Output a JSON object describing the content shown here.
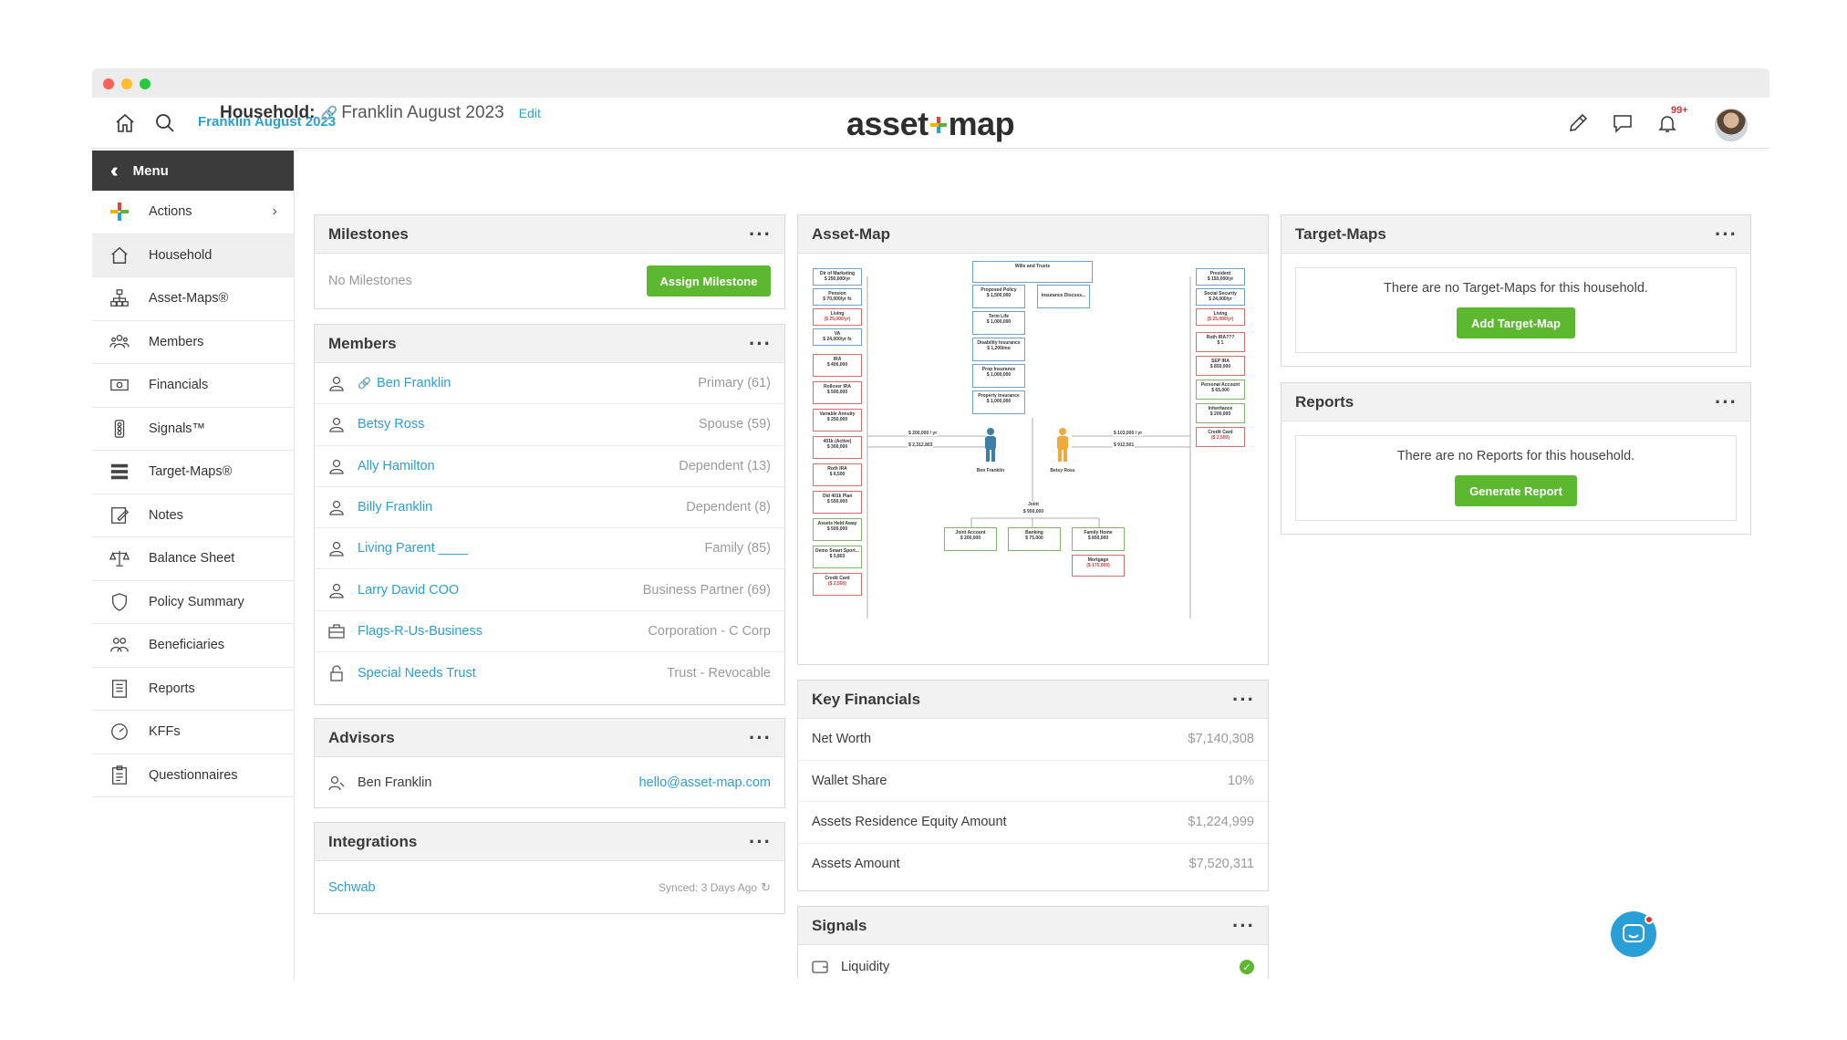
{
  "topnav": {
    "household": "Franklin August 2023",
    "logo_left": "asset",
    "logo_right": "map",
    "notification_count": "99+"
  },
  "sidebar": {
    "menu_label": "Menu",
    "items": [
      {
        "label": "Actions",
        "icon": "actions-plus-icon"
      },
      {
        "label": "Household",
        "icon": "house-icon"
      },
      {
        "label": "Asset-Maps®",
        "icon": "asset-map-icon"
      },
      {
        "label": "Members",
        "icon": "members-icon"
      },
      {
        "label": "Financials",
        "icon": "financials-icon"
      },
      {
        "label": "Signals™",
        "icon": "signals-icon"
      },
      {
        "label": "Target-Maps®",
        "icon": "target-maps-icon"
      },
      {
        "label": "Notes",
        "icon": "notes-icon"
      },
      {
        "label": "Balance Sheet",
        "icon": "balance-sheet-icon"
      },
      {
        "label": "Policy Summary",
        "icon": "policy-summary-icon"
      },
      {
        "label": "Beneficiaries",
        "icon": "beneficiaries-icon"
      },
      {
        "label": "Reports",
        "icon": "reports-icon"
      },
      {
        "label": "KFFs",
        "icon": "kffs-icon"
      },
      {
        "label": "Questionnaires",
        "icon": "questionnaires-icon"
      }
    ]
  },
  "page": {
    "title_label": "Household:",
    "household_name": "Franklin August 2023",
    "edit_label": "Edit"
  },
  "milestones": {
    "title": "Milestones",
    "empty": "No Milestones",
    "button": "Assign Milestone"
  },
  "members": {
    "title": "Members",
    "rows": [
      {
        "name": "Ben Franklin",
        "role": "Primary (61)",
        "icon": "person-icon",
        "linked": true
      },
      {
        "name": "Betsy Ross",
        "role": "Spouse (59)",
        "icon": "person-icon"
      },
      {
        "name": "Ally Hamilton",
        "role": "Dependent (13)",
        "icon": "person-icon"
      },
      {
        "name": "Billy Franklin",
        "role": "Dependent (8)",
        "icon": "person-icon"
      },
      {
        "name": "Living Parent ____",
        "role": "Family (85)",
        "icon": "person-icon"
      },
      {
        "name": "Larry David COO",
        "role": "Business Partner (69)",
        "icon": "person-icon"
      },
      {
        "name": "Flags-R-Us-Business",
        "role": "Corporation - C Corp",
        "icon": "briefcase-icon"
      },
      {
        "name": "Special Needs Trust",
        "role": "Trust - Revocable",
        "icon": "lock-icon"
      }
    ]
  },
  "advisors": {
    "title": "Advisors",
    "name": "Ben Franklin",
    "email": "hello@asset-map.com"
  },
  "integrations": {
    "title": "Integrations",
    "name": "Schwab",
    "synced": "Synced: 3 Days Ago"
  },
  "asset_map": {
    "title": "Asset-Map",
    "left_income": [
      {
        "title": "Dir of Marketing",
        "value": "$ 250,000/yr"
      },
      {
        "title": "Pension",
        "value": "$ 70,000/yr fx"
      },
      {
        "title": "Living",
        "value": "($ 25,000/yr)"
      },
      {
        "title": "VA",
        "value": "$ 24,000/yr fx"
      }
    ],
    "left_assets": [
      {
        "title": "IRA",
        "value": "$ 400,000"
      },
      {
        "title": "Rollover IRA",
        "value": "$ 500,000"
      },
      {
        "title": "Variable Annuity",
        "value": "$ 250,000"
      },
      {
        "title": "401k (Active)",
        "value": "$ 300,000"
      },
      {
        "title": "Roth IRA",
        "value": "$ 6,500"
      },
      {
        "title": "Old 401k Plan",
        "value": "$ 550,000"
      },
      {
        "title": "Assets Held Away",
        "value": "$ 500,000"
      },
      {
        "title": "Demo Smart Sport...",
        "value": "$ 5,803"
      },
      {
        "title": "Credit Card",
        "value": "($ 2,500)"
      }
    ],
    "center_top": [
      {
        "title": "Wills and Trusts",
        "value": ""
      },
      {
        "title": "Proposed Policy",
        "value": "$ 1,500,000"
      },
      {
        "title": "Term Life",
        "value": "$ 1,000,000"
      },
      {
        "title": "Disability Insurance",
        "value": "$ 1,200/mo"
      },
      {
        "title": "Prop Insurance",
        "value": "$ 1,000,000"
      },
      {
        "title": "Property Insurance",
        "value": "$ 1,000,000"
      }
    ],
    "insurance_side": "Insurance Discuss...",
    "right_income": [
      {
        "title": "President",
        "value": "$ 150,000/yr"
      },
      {
        "title": "Social Security",
        "value": "$ 24,000/yr"
      },
      {
        "title": "Living",
        "value": "($ 25,000/yr)"
      }
    ],
    "right_assets": [
      {
        "title": "Roth IRA???",
        "value": "$ 1"
      },
      {
        "title": "SEP IRA",
        "value": "$ 850,000"
      },
      {
        "title": "Personal Account",
        "value": "$ 65,000"
      },
      {
        "title": "Inheritance",
        "value": "$ 200,000"
      },
      {
        "title": "Credit Card",
        "value": "($ 2,500)"
      }
    ],
    "left_flow_in": "$ 200,000 / yr",
    "left_flow_out": "$ 2,312,803",
    "right_flow_in": "$ 103,000 / yr",
    "right_flow_out": "$ 912,501",
    "person_left": "Ben Franklin",
    "person_right": "Betsy Ross",
    "joint_label": "Joint",
    "joint_value": "$ 950,000",
    "bottom": [
      {
        "title": "Joint Account",
        "value": "$ 200,000"
      },
      {
        "title": "Banking",
        "value": "$ 75,000"
      },
      {
        "title": "Family Home",
        "value": "$ 850,000"
      }
    ],
    "mortgage": {
      "title": "Mortgage",
      "value": "($ 175,000)"
    }
  },
  "key_financials": {
    "title": "Key Financials",
    "rows": [
      {
        "label": "Net Worth",
        "value": "$7,140,308"
      },
      {
        "label": "Wallet Share",
        "value": "10%"
      },
      {
        "label": "Assets Residence Equity Amount",
        "value": "$1,224,999"
      },
      {
        "label": "Assets Amount",
        "value": "$7,520,311"
      }
    ]
  },
  "signals": {
    "title": "Signals",
    "rows": [
      {
        "label": "Liquidity",
        "status": "ok"
      }
    ]
  },
  "target_maps": {
    "title": "Target-Maps",
    "empty": "There are no Target-Maps for this household.",
    "button": "Add Target-Map"
  },
  "reports": {
    "title": "Reports",
    "empty": "There are no Reports for this household.",
    "button": "Generate Report"
  },
  "colors": {
    "accent_blue": "#2a9fd6",
    "green": "#5cb82e",
    "sidebar_dark": "#3b3b3b",
    "alert_red": "#e03333"
  }
}
